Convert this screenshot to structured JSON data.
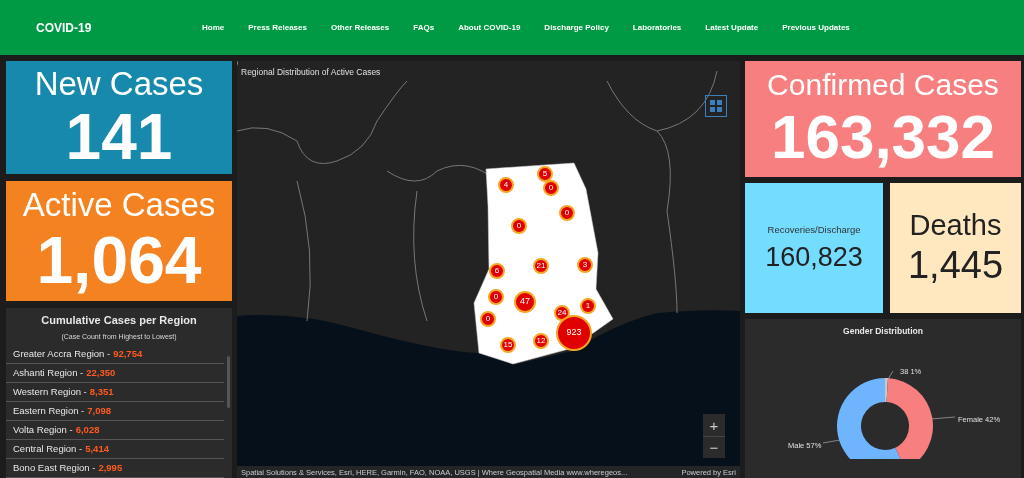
{
  "header": {
    "brand": "COVID-19",
    "nav": [
      {
        "label": "Home"
      },
      {
        "label": "Press Releases"
      },
      {
        "label": "Other Releases"
      },
      {
        "label": "FAQs"
      },
      {
        "label": "About COVID-19"
      },
      {
        "label": "Discharge Policy"
      },
      {
        "label": "Laboratories"
      },
      {
        "label": "Latest Update"
      },
      {
        "label": "Previous Updates"
      }
    ]
  },
  "new_cases": {
    "title": "New Cases",
    "value": "141"
  },
  "active_cases": {
    "title": "Active Cases",
    "value": "1,064"
  },
  "regions": {
    "title": "Cumulative Cases per Region",
    "subtitle": "(Case Count from Highest to Lowest)",
    "rows": [
      {
        "name": "Greater Accra Region -",
        "count": "92,754"
      },
      {
        "name": "Ashanti Region -",
        "count": "22,350"
      },
      {
        "name": "Western Region -",
        "count": "8,351"
      },
      {
        "name": "Eastern Region -",
        "count": "7,098"
      },
      {
        "name": "Volta Region -",
        "count": "6,028"
      },
      {
        "name": "Central Region -",
        "count": "5,414"
      },
      {
        "name": "Bono East Region -",
        "count": "2,995"
      }
    ]
  },
  "map": {
    "title": "Regional Distribution of Active Cases",
    "clusters": [
      "5",
      "4",
      "0",
      "0",
      "0",
      "21",
      "3",
      "6",
      "0",
      "47",
      "1",
      "24",
      "0",
      "923",
      "15",
      "12"
    ],
    "attribution": "Spatial Solutions & Services, Esri, HERE, Garmin, FAO, NOAA, USGS | Where Geospatial Media www.wheregeos...",
    "powered_by": "Powered by Esri",
    "zoom_in": "+",
    "zoom_out": "−"
  },
  "confirmed_cases": {
    "title": "Confirmed Cases",
    "value": "163,332"
  },
  "recoveries": {
    "title": "Recoveries/Discharge",
    "value": "160,823"
  },
  "deaths": {
    "title": "Deaths",
    "value": "1,445"
  },
  "gender": {
    "chart_data": {
      "type": "donut",
      "title": "Gender Distribution",
      "categories": [
        "38 1%",
        "Female 42%",
        "Male 57%"
      ],
      "values": [
        1,
        42,
        57
      ]
    }
  }
}
